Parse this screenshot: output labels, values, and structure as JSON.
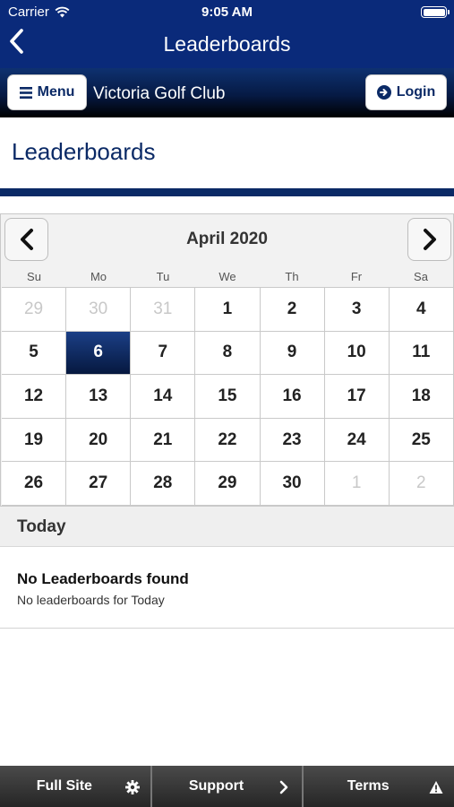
{
  "status": {
    "carrier": "Carrier",
    "time": "9:05 AM"
  },
  "header": {
    "title": "Leaderboards"
  },
  "clubbar": {
    "menu_label": "Menu",
    "club_name": "Victoria Golf Club",
    "login_label": "Login"
  },
  "page": {
    "title": "Leaderboards"
  },
  "calendar": {
    "month_label": "April 2020",
    "weekdays": [
      "Su",
      "Mo",
      "Tu",
      "We",
      "Th",
      "Fr",
      "Sa"
    ],
    "days": [
      {
        "d": "29",
        "muted": true
      },
      {
        "d": "30",
        "muted": true
      },
      {
        "d": "31",
        "muted": true
      },
      {
        "d": "1"
      },
      {
        "d": "2"
      },
      {
        "d": "3"
      },
      {
        "d": "4"
      },
      {
        "d": "5"
      },
      {
        "d": "6",
        "selected": true
      },
      {
        "d": "7"
      },
      {
        "d": "8"
      },
      {
        "d": "9"
      },
      {
        "d": "10"
      },
      {
        "d": "11"
      },
      {
        "d": "12"
      },
      {
        "d": "13"
      },
      {
        "d": "14"
      },
      {
        "d": "15"
      },
      {
        "d": "16"
      },
      {
        "d": "17"
      },
      {
        "d": "18"
      },
      {
        "d": "19"
      },
      {
        "d": "20"
      },
      {
        "d": "21"
      },
      {
        "d": "22"
      },
      {
        "d": "23"
      },
      {
        "d": "24"
      },
      {
        "d": "25"
      },
      {
        "d": "26"
      },
      {
        "d": "27"
      },
      {
        "d": "28"
      },
      {
        "d": "29"
      },
      {
        "d": "30"
      },
      {
        "d": "1",
        "muted": true
      },
      {
        "d": "2",
        "muted": true
      }
    ]
  },
  "today": {
    "label": "Today",
    "empty_title": "No Leaderboards found",
    "empty_sub": "No leaderboards for Today"
  },
  "footer": {
    "full_site": "Full Site",
    "support": "Support",
    "terms": "Terms"
  },
  "colors": {
    "header_blue": "#0a2a7a",
    "brand_navy": "#0b2a66",
    "selected_day": "#102d66"
  },
  "icons": [
    "wifi-icon",
    "battery-icon",
    "back-chevron-icon",
    "hamburger-icon",
    "login-arrow-icon",
    "chevron-left-icon",
    "chevron-right-icon",
    "gear-icon",
    "warning-icon"
  ]
}
